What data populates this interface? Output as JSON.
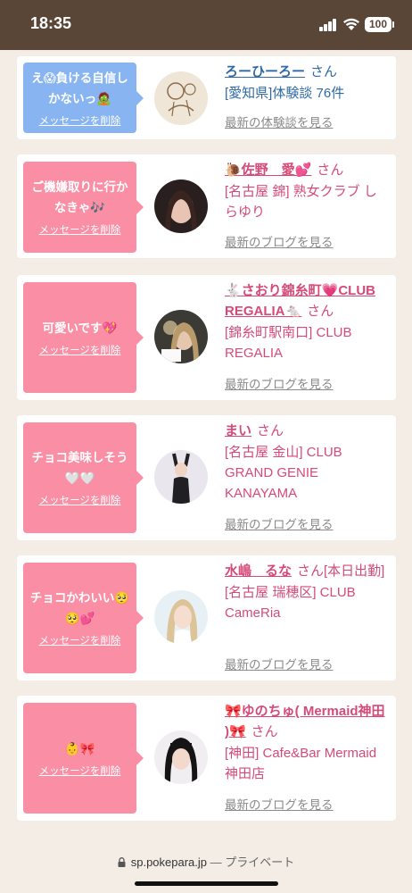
{
  "status_bar": {
    "time": "18:35",
    "battery": "100"
  },
  "delete_label": "メッセージを削除",
  "entries": [
    {
      "message": "え😱負ける自信しかないっ🧟",
      "name": "ろーひーろー",
      "san": "さん",
      "shop": "[愛知県]体験談 76件",
      "link": "最新の体験談を見る",
      "color": "blue"
    },
    {
      "message": "ご機嫌取りに行かなきゃ🎶",
      "name": "🐌佐野　愛💕",
      "san": "さん",
      "shop": "[名古屋 錦] 熟女クラブ しらゆり",
      "link": "最新のブログを見る",
      "color": "pink"
    },
    {
      "message": "可愛いです💖",
      "name": "🐇さおり錦糸町💗CLUB REGALIA🐁",
      "san": "さん",
      "shop": "[錦糸町駅南口] CLUB REGALIA",
      "link": "最新のブログを見る",
      "color": "pink"
    },
    {
      "message": "チョコ美味しそう🤍🤍",
      "name": "まい",
      "san": "さん",
      "shop": "[名古屋 金山] CLUB GRAND GENIE KANAYAMA",
      "link": "最新のブログを見る",
      "color": "pink"
    },
    {
      "message": "チョコかわいい🥺🥺💕",
      "name": "水嶋　るな",
      "san": "さん[本日出勤]",
      "shop": "[名古屋 瑞穂区] CLUB CameRia",
      "link": "最新のブログを見る",
      "color": "pink"
    },
    {
      "message": "👶🎀",
      "name": "🎀ゆのちゅ( Mermaid神田 )🎀",
      "san": "さん",
      "shop": "[神田] Cafe&Bar Mermaid 神田店",
      "link": "最新のブログを見る",
      "color": "pink"
    }
  ],
  "bottom_bar": {
    "url": "sp.pokepara.jp",
    "privacy": "— プライベート"
  },
  "colors": {
    "pink_bubble": "#fa8ea5",
    "blue_bubble": "#88b5f1",
    "pink_text": "#d64a78",
    "blue_text": "#2f6aa6",
    "status_bar": "#5a4636"
  }
}
